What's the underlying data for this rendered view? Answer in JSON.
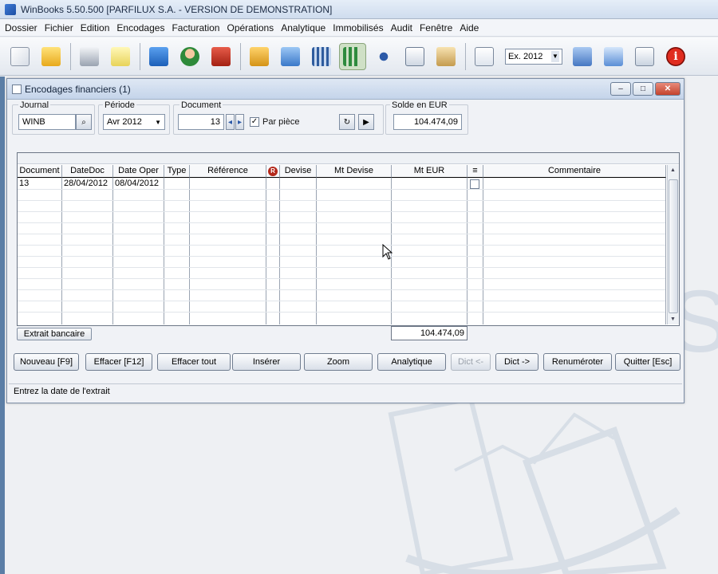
{
  "app": {
    "title": "WinBooks 5.50.500 [PARFILUX S.A. - VERSION DE DEMONSTRATION]"
  },
  "menu": [
    "Dossier",
    "Fichier",
    "Edition",
    "Encodages",
    "Facturation",
    "Opérations",
    "Analytique",
    "Immobilisés",
    "Audit",
    "Fenêtre",
    "Aide"
  ],
  "toolbar": {
    "exercise_value": "Ex. 2012",
    "icons": [
      "new-file-icon",
      "folder-icon",
      "printer-icon",
      "notepad-icon",
      "book-icon",
      "user-icon",
      "truck-icon",
      "box-icon",
      "tree-icon",
      "building-icon",
      "chart-icon",
      "scissors-icon",
      "copy-icon",
      "paste-icon",
      "document-icon",
      "calculator-icon",
      "network-icon",
      "mail-icon",
      "info-icon"
    ]
  },
  "window": {
    "title": "Encodages financiers  (1)",
    "fields": {
      "journal_label": "Journal",
      "journal_value": "WINB",
      "periode_label": "Période",
      "periode_value": "Avr 2012",
      "document_label": "Document",
      "document_value": "13",
      "par_piece_label": "Par pièce",
      "par_piece_checked": "✓",
      "solde_label": "Solde en EUR",
      "solde_value": "104.474,09"
    },
    "grid": {
      "headers": [
        "Document",
        "DateDoc",
        "Date Oper",
        "Type",
        "Référence",
        "R",
        "Devise",
        "Mt Devise",
        "Mt EUR",
        "≡",
        "Commentaire"
      ],
      "rows": [
        {
          "document": "13",
          "datedoc": "28/04/2012",
          "dateoper": "08/04/2012"
        }
      ],
      "total_eur": "104.474,09"
    },
    "extrait_button": "Extrait bancaire",
    "buttons": {
      "nouveau": "Nouveau [F9]",
      "effacer": "Effacer [F12]",
      "effacer_tout": "Effacer tout",
      "inserer": "Insérer",
      "zoom": "Zoom",
      "analytique": "Analytique",
      "dict_prev": "Dict <-",
      "dict_next": "Dict ->",
      "renumerote": "Renuméroter",
      "quitter": "Quitter [Esc]"
    },
    "status": "Entrez la date de l'extrait"
  },
  "colors": {
    "accent": "#3f7bd6",
    "close": "#c4432d",
    "strip": "#5b7ea6"
  }
}
